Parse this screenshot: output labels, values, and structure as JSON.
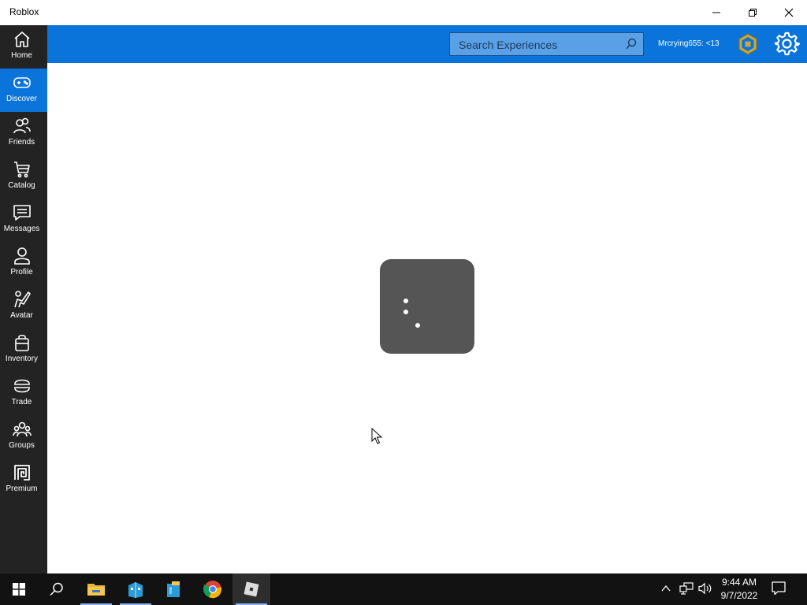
{
  "window": {
    "title": "Roblox"
  },
  "sidebar": {
    "items": [
      {
        "label": "Home",
        "icon": "home-icon",
        "active": false
      },
      {
        "label": "Discover",
        "icon": "gamepad-icon",
        "active": true
      },
      {
        "label": "Friends",
        "icon": "friends-icon",
        "active": false
      },
      {
        "label": "Catalog",
        "icon": "cart-icon",
        "active": false
      },
      {
        "label": "Messages",
        "icon": "message-icon",
        "active": false
      },
      {
        "label": "Profile",
        "icon": "profile-icon",
        "active": false
      },
      {
        "label": "Avatar",
        "icon": "avatar-icon",
        "active": false
      },
      {
        "label": "Inventory",
        "icon": "inventory-icon",
        "active": false
      },
      {
        "label": "Trade",
        "icon": "trade-icon",
        "active": false
      },
      {
        "label": "Groups",
        "icon": "groups-icon",
        "active": false
      },
      {
        "label": "Premium",
        "icon": "premium-icon",
        "active": false
      }
    ]
  },
  "header": {
    "search": {
      "placeholder": "Search Experiences"
    },
    "username": "Mrcrying655: <13",
    "icons": [
      "robux-icon",
      "settings-icon"
    ]
  },
  "taskbar": {
    "apps": [
      "start-icon",
      "search-icon",
      "file-explorer-icon",
      "app-icon-1",
      "app-icon-2",
      "chrome-icon",
      "roblox-icon"
    ],
    "time": "9:44 AM",
    "date": "9/7/2022"
  },
  "colors": {
    "accent": "#0a74da",
    "sidebar_bg": "#232323",
    "loader_bg": "#555555",
    "taskbar_bg": "#121212"
  }
}
